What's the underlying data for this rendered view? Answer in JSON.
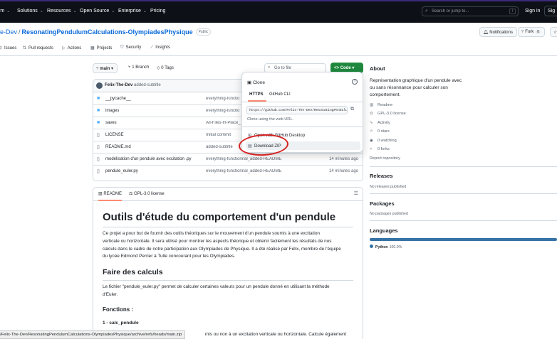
{
  "topbar": {
    "nav": [
      "rm",
      "Solutions",
      "Resources",
      "Open Source",
      "Enterprise",
      "Pricing"
    ],
    "search_placeholder": "Search or jump to...",
    "search_key": "/",
    "sign_in": "Sign in",
    "sign_up": "Sig"
  },
  "repo": {
    "owner": "e-Dev",
    "separator": "/",
    "name": "ResonatingPendulumCalculations-OlympiadesPhysique",
    "visibility": "Public",
    "notifications_label": "Notifications",
    "fork_label": "Fork",
    "fork_count": "0"
  },
  "tabs": [
    "Issues",
    "Pull requests",
    "Actions",
    "Projects",
    "Security",
    "Insights"
  ],
  "toolbar": {
    "branch": "main",
    "branches": "1 Branch",
    "tags": "0 Tags",
    "goto_file": "Go to file",
    "code_label": "Code"
  },
  "commit": {
    "author": "Felix-The-Dev",
    "message": "added-subtitle"
  },
  "files": [
    {
      "type": "folder",
      "name": "__pycache__",
      "commit": "everything-functio",
      "time": ""
    },
    {
      "type": "folder",
      "name": "images",
      "commit": "everything-functio",
      "time": ""
    },
    {
      "type": "folder",
      "name": "saves",
      "commit": "All-Files-In-Place_Ti",
      "time": ""
    },
    {
      "type": "file",
      "name": "LICENSE",
      "commit": "Initial commit",
      "time": ""
    },
    {
      "type": "file",
      "name": "README.md",
      "commit": "added-subtitle",
      "time": ""
    },
    {
      "type": "file",
      "name": "modélisation d'un pendule avec excitation .py",
      "commit": "everything-functionnal_added-README",
      "time": "14 minutes ago"
    },
    {
      "type": "file",
      "name": "pendule_euler.py",
      "commit": "everything-functionnal_added-README",
      "time": "14 minutes ago"
    }
  ],
  "readme": {
    "tab_readme": "README",
    "tab_license": "GPL-3.0 license",
    "h1": "Outils d'étude du comportement d'un pendule",
    "intro_lines": [
      "Ce projet a pour but de fournir des outils théoriques sur le mouvement d'un pendule soumis à une excitation",
      "verticale ou horizontale. Il sera utilisé pour montrer les aspects théorique et obtenir facilement les résultats de nos",
      "calculs dans le cadre de notre participation aux Olympiades de Physique. Il a été réalisé par Félix, membre de l'équipe",
      "du lycée Edmond Perrier à Tulle concourant pour les Olympiades."
    ],
    "h2": "Faire des calculs",
    "calc_lines": [
      "Le fichier \"pendule_euler.py\" permet de calculer certaines valeurs pour un pendule donné en utilisant la méthode",
      "d'Euler."
    ],
    "h3": "Fonctions :",
    "h4": "1 - calc_pendule",
    "tail": "mis ou non à un excitation verticale ou horizontale. Calcule également"
  },
  "about": {
    "heading": "About",
    "description": "Représentation graphique d'un pendule avec ou sans résonnance pour calculer son comportement.",
    "links": [
      "Readme",
      "GPL-3.0 license",
      "Activity",
      "0 stars",
      "0 watching",
      "0 forks"
    ],
    "report": "Report repository"
  },
  "releases": {
    "heading": "Releases",
    "note": "No releases published"
  },
  "packages": {
    "heading": "Packages",
    "note": "No packages published"
  },
  "languages": {
    "heading": "Languages",
    "name": "Python",
    "percent": "100.0%",
    "color": "#3572A5"
  },
  "clone": {
    "title": "Clone",
    "tab_https": "HTTPS",
    "tab_cli": "GitHub CLI",
    "url": "https://github.com/Felix-The-Dev/ResonatingPendulumCalculations-OlympiadesPhysique.git",
    "hint": "Clone using the web URL.",
    "open_desktop": "Open with GitHub Desktop",
    "download_zip": "Download ZIP"
  },
  "status_url": "/Felix-The-Dev/ResonatingPendulumCalculations-OlympiadesPhysique/archive/refs/heads/main.zip",
  "colors": {
    "accent": "#1f883d",
    "link": "#0969da",
    "annotation": "#d62222",
    "topbar": "#0d1117"
  }
}
